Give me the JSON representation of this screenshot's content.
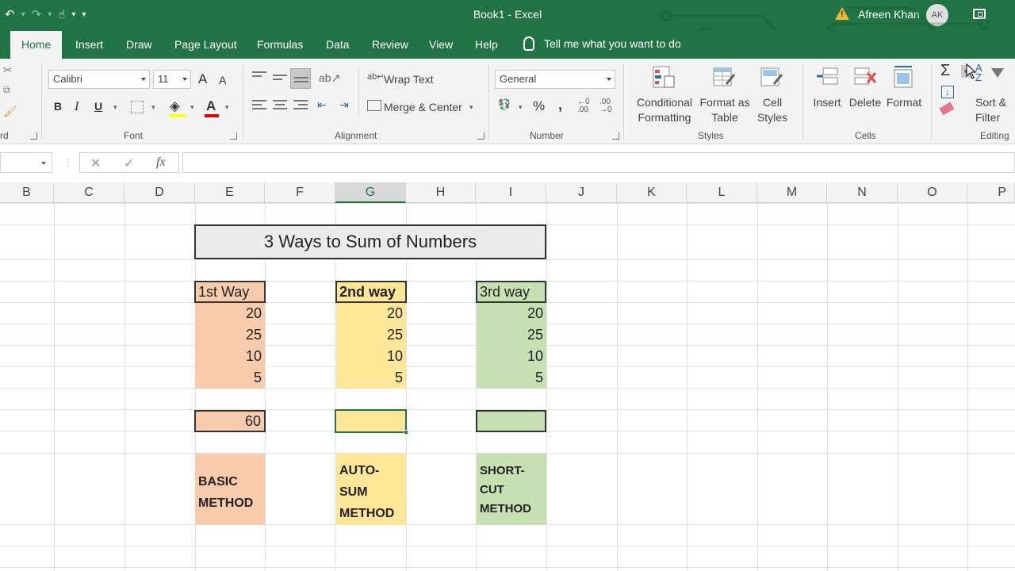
{
  "titlebar": {
    "title": "Book1  -  Excel",
    "user_name": "Afreen Khan",
    "user_initials": "AK"
  },
  "tabs": [
    {
      "label": "Home",
      "active": true
    },
    {
      "label": "Insert"
    },
    {
      "label": "Draw"
    },
    {
      "label": "Page Layout"
    },
    {
      "label": "Formulas"
    },
    {
      "label": "Data"
    },
    {
      "label": "Review"
    },
    {
      "label": "View"
    },
    {
      "label": "Help"
    }
  ],
  "tell_me": "Tell me what you want to do",
  "ribbon": {
    "clipboard_label_fragment": "rd",
    "font": {
      "label": "Font",
      "family": "Calibri",
      "size": "11",
      "bold": "B",
      "italic": "I",
      "underline": "U",
      "grow": "A",
      "shrink": "A",
      "font_color_letter": "A",
      "font_color": "#e00000"
    },
    "alignment": {
      "label": "Alignment",
      "wrap_text": "Wrap Text",
      "merge_center": "Merge & Center"
    },
    "number": {
      "label": "Number",
      "format": "General",
      "percent": "%",
      "comma": ","
    },
    "styles": {
      "label": "Styles",
      "conditional_formatting": [
        "Conditional",
        "Formatting"
      ],
      "format_as_table": [
        "Format as",
        "Table"
      ],
      "cell_styles": [
        "Cell",
        "Styles"
      ]
    },
    "cells": {
      "label": "Cells",
      "insert": "Insert",
      "delete": "Delete",
      "format": "Format"
    },
    "editing": {
      "label": "Editing",
      "autosum": "Σ",
      "sort_filter": [
        "Sort &",
        "Filter"
      ]
    }
  },
  "formula_bar": {
    "name_box": "",
    "fx": "fx",
    "cancel": "✕",
    "enter": "✓",
    "content": ""
  },
  "columns": [
    "B",
    "C",
    "D",
    "E",
    "F",
    "G",
    "H",
    "I",
    "J",
    "K",
    "L",
    "M",
    "N",
    "O",
    "P"
  ],
  "selected_column": "G",
  "sheet": {
    "title": "3 Ways to Sum of Numbers",
    "ways": [
      {
        "header": "1st Way",
        "values": [
          "20",
          "25",
          "10",
          "5"
        ],
        "total": "60",
        "method": [
          "BASIC",
          "METHOD"
        ],
        "color": "#f8cbad"
      },
      {
        "header": "2nd way",
        "values": [
          "20",
          "25",
          "10",
          "5"
        ],
        "total": "",
        "method": [
          "AUTO-",
          "SUM",
          "METHOD"
        ],
        "color": "#ffe699"
      },
      {
        "header": "3rd way",
        "values": [
          "20",
          "25",
          "10",
          "5"
        ],
        "total": "",
        "method": [
          "SHORT-",
          "CUT",
          "METHOD"
        ],
        "color": "#c6e0b4"
      }
    ]
  },
  "colors": {
    "brand": "#217346",
    "warning": "#f2b72a"
  }
}
